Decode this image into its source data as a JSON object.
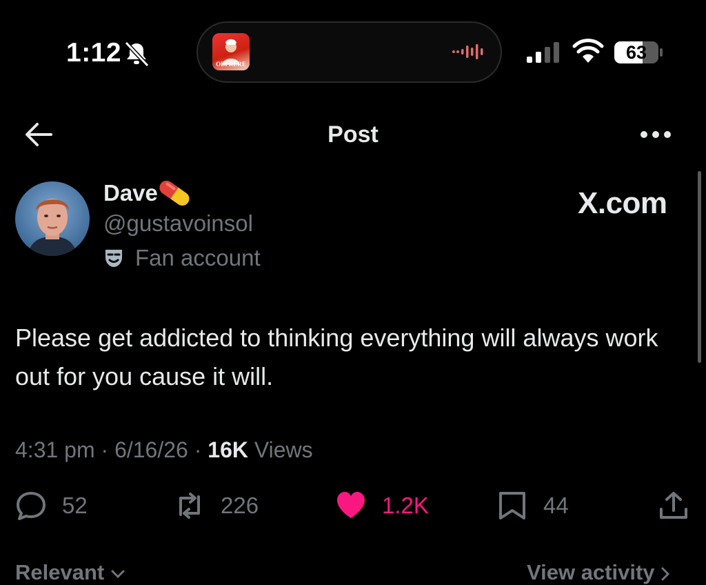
{
  "status_bar": {
    "time": "1:12",
    "battery": "63",
    "now_playing_art_text": "OBI RERE",
    "icons": [
      "bell-slash-icon",
      "waveform-icon",
      "cellular-signal-icon",
      "wifi-icon",
      "battery-icon"
    ]
  },
  "header": {
    "title": "Post",
    "back_icon": "arrow-left-icon",
    "more_icon": "ellipsis-icon"
  },
  "post": {
    "display_name": "Dave",
    "name_emoji": "pill",
    "handle": "@gustavoinsol",
    "label": "Fan account",
    "label_icon": "theater-mask-icon",
    "watermark": "X.com",
    "text": "Please get addicted to thinking everything will always work out for you cause it will.",
    "time": "4:31 pm",
    "date": "6/16/26",
    "views_count": "16K",
    "views_label": "Views",
    "sep": "·"
  },
  "actions": {
    "replies": "52",
    "reposts": "226",
    "likes": "1.2K",
    "bookmarks": "44",
    "liked_color": "#f91880"
  },
  "footer": {
    "sort_label": "Relevant",
    "activity_label": "View activity"
  }
}
